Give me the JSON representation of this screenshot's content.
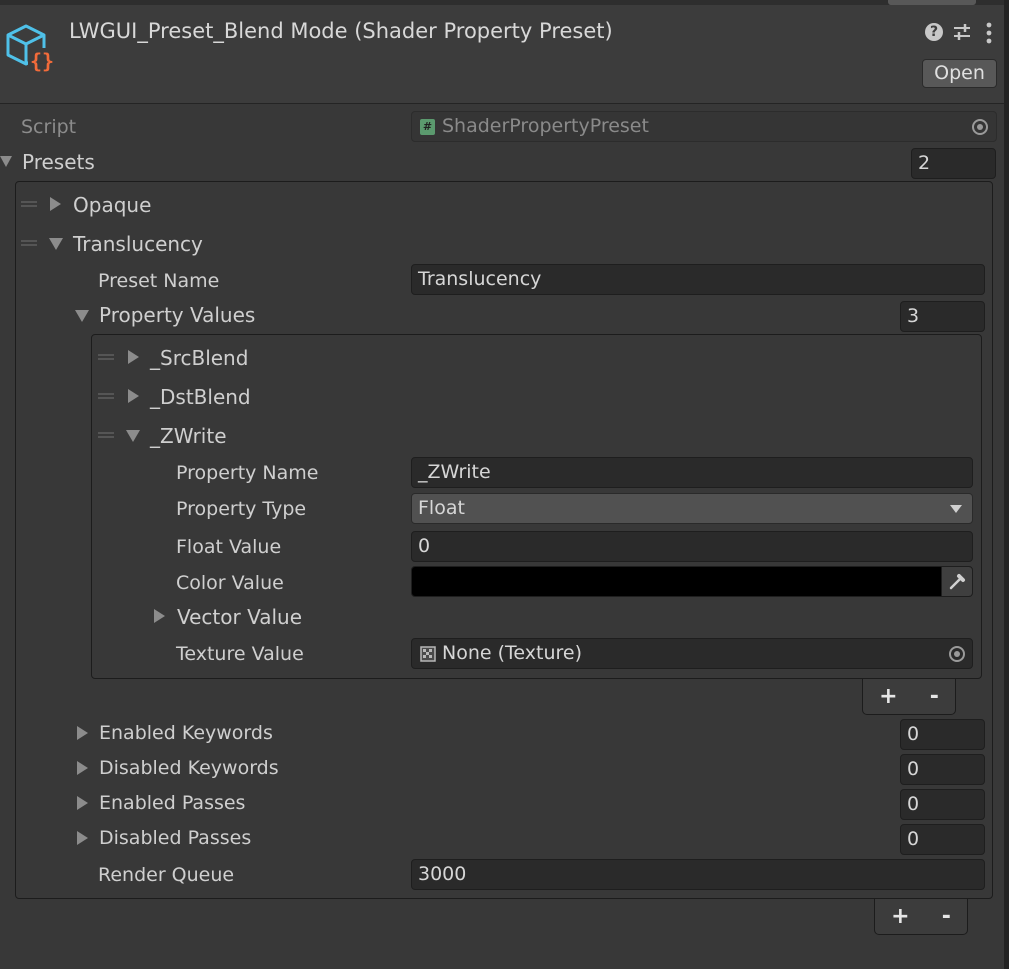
{
  "header": {
    "title": "LWGUI_Preset_Blend Mode (Shader Property Preset)",
    "open_label": "Open",
    "help_icon": "?"
  },
  "script_row": {
    "label": "Script",
    "value": "ShaderPropertyPreset"
  },
  "presets": {
    "label": "Presets",
    "count": "2",
    "items": [
      {
        "label": "Opaque",
        "expanded": false
      },
      {
        "label": "Translucency",
        "expanded": true
      }
    ],
    "translucency": {
      "preset_name_label": "Preset Name",
      "preset_name_value": "Translucency",
      "property_values_label": "Property Values",
      "property_values_count": "3",
      "properties": [
        {
          "label": "_SrcBlend",
          "expanded": false
        },
        {
          "label": "_DstBlend",
          "expanded": false
        },
        {
          "label": "_ZWrite",
          "expanded": true
        }
      ],
      "zwrite": {
        "property_name_label": "Property Name",
        "property_name_value": "_ZWrite",
        "property_type_label": "Property Type",
        "property_type_value": "Float",
        "float_value_label": "Float Value",
        "float_value": "0",
        "color_value_label": "Color Value",
        "color_value": "#000000",
        "vector_value_label": "Vector Value",
        "texture_value_label": "Texture Value",
        "texture_value": "None (Texture)"
      },
      "add_label": "+",
      "remove_label": "-",
      "enabled_keywords_label": "Enabled Keywords",
      "enabled_keywords_count": "0",
      "disabled_keywords_label": "Disabled Keywords",
      "disabled_keywords_count": "0",
      "enabled_passes_label": "Enabled Passes",
      "enabled_passes_count": "0",
      "disabled_passes_label": "Disabled Passes",
      "disabled_passes_count": "0",
      "render_queue_label": "Render Queue",
      "render_queue_value": "3000"
    },
    "add_label": "+",
    "remove_label": "-"
  },
  "colors": {
    "background": "#383838",
    "field": "#2a2a2a",
    "icon_blue": "#4fc1e9",
    "icon_orange": "#f26b3a"
  }
}
